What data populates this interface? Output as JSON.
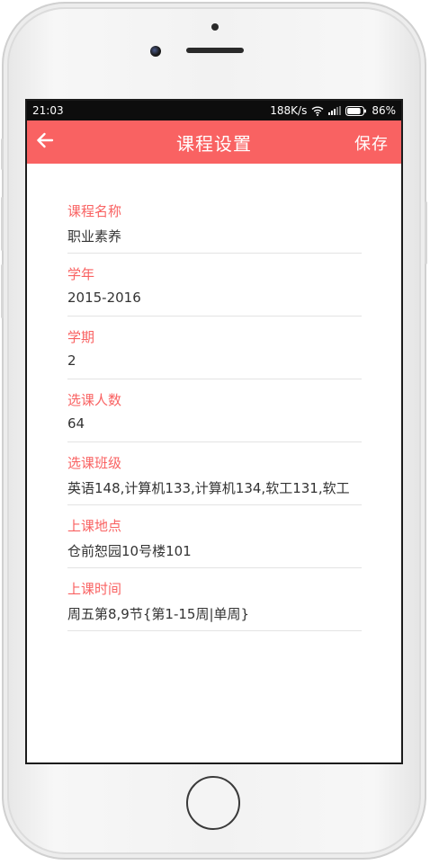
{
  "status_bar": {
    "time": "21:03",
    "net_speed": "188K/s",
    "battery_percent": "86%",
    "battery_level": 0.86
  },
  "header": {
    "title": "课程设置",
    "save_label": "保存",
    "back_icon": "arrow-left-icon",
    "color": "#f96262"
  },
  "fields": [
    {
      "label": "课程名称",
      "value": "职业素养"
    },
    {
      "label": "学年",
      "value": "2015-2016"
    },
    {
      "label": "学期",
      "value": "2"
    },
    {
      "label": "选课人数",
      "value": "64"
    },
    {
      "label": "选课班级",
      "value": "英语148,计算机133,计算机134,软工131,软工"
    },
    {
      "label": "上课地点",
      "value": "仓前恕园10号楼101"
    },
    {
      "label": "上课时间",
      "value": "周五第8,9节{第1-15周|单周}"
    }
  ],
  "colors": {
    "accent": "#f96262",
    "label": "#f96262",
    "value_text": "#333333",
    "status_bar": "#0d0d0d"
  }
}
